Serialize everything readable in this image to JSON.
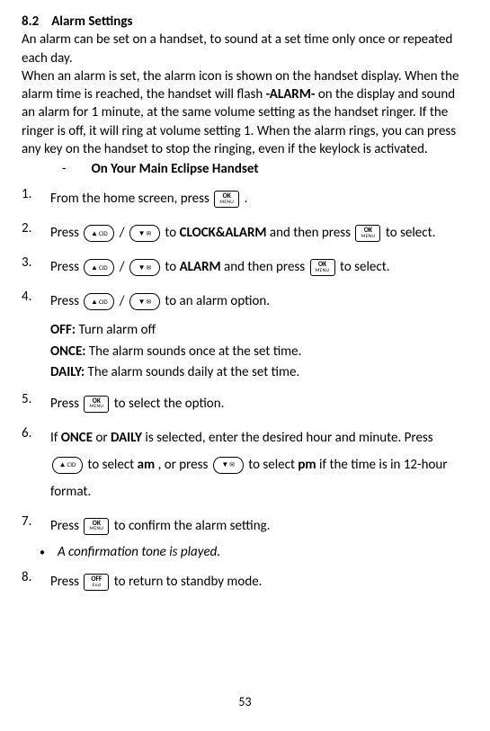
{
  "heading": {
    "number": "8.2",
    "title": "Alarm Settings"
  },
  "intro": {
    "p1": "An alarm can be set on a handset, to sound at a set time only once or repeated each day.",
    "p2a": "When an alarm is set, the alarm icon is shown on the handset display. When the alarm time is reached, the handset will flash ",
    "p2b": "-ALARM-",
    "p2c": " on the display and sound an alarm for 1 minute, at the same volume setting as the handset ringer. If the ringer is off, it will ring at volume setting 1. When the alarm rings, you can press any key on the handset to stop the ringing, even if the keylock is activated."
  },
  "subheading": "On Your Main Eclipse Handset",
  "keys": {
    "ok_top": "OK",
    "ok_bottom": "MENU",
    "up_pre": "▲",
    "up_post": "CID",
    "down_pre": "▼",
    "down_post": "✉",
    "off_top": "OFF",
    "off_bottom": "End"
  },
  "steps": {
    "s1": {
      "n": "1.",
      "a": "From the home screen, press ",
      "b": " ."
    },
    "s2": {
      "n": "2.",
      "a": "Press ",
      "b": " / ",
      "c": " to ",
      "d": "CLOCK&ALARM",
      "e": " and then press ",
      "f": " to select."
    },
    "s3": {
      "n": "3.",
      "a": "Press ",
      "b": " / ",
      "c": " to ",
      "d": "ALARM",
      "e": " and then press ",
      "f": " to select."
    },
    "s4": {
      "n": "4.",
      "a": "Press ",
      "b": " / ",
      "c": " to an alarm option."
    },
    "opts": {
      "off_l": "OFF:",
      "off_t": " Turn alarm off",
      "once_l": "ONCE:",
      "once_t": " The alarm sounds once at the set time.",
      "daily_l": "DAILY:",
      "daily_t": " The alarm sounds daily at the set time."
    },
    "s5": {
      "n": "5.",
      "a": "Press ",
      "b": " to select the option."
    },
    "s6": {
      "n": "6.",
      "a": "If ",
      "b": "ONCE",
      "c": " or ",
      "d": "DAILY",
      "e": " is selected, enter the desired hour and minute. Press ",
      "f": " to select ",
      "g": "am",
      "h": ", or press ",
      "i": " to select ",
      "j": "pm",
      "k": " if the time is in 12-hour format."
    },
    "s7": {
      "n": "7.",
      "a": "Press ",
      "b": " to confirm the alarm setting."
    },
    "note": "A confirmation tone is played.",
    "s8": {
      "n": "8.",
      "a": "Press ",
      "b": " to return to standby mode."
    }
  },
  "page": "53"
}
